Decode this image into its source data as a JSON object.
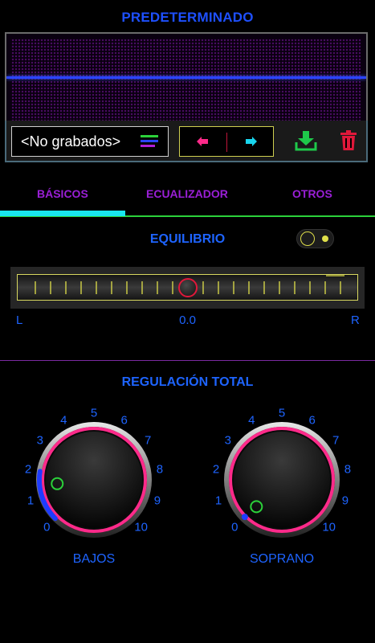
{
  "header": {
    "title": "PREDETERMINADO"
  },
  "preset": {
    "label": "<No grabados>"
  },
  "tabs": [
    {
      "label": "BÁSICOS",
      "active": true
    },
    {
      "label": "ECUALIZADOR",
      "active": false
    },
    {
      "label": "OTROS",
      "active": false
    }
  ],
  "balance": {
    "title": "EQUILIBRIO",
    "enabled": true,
    "left_label": "L",
    "right_label": "R",
    "value": "0.0"
  },
  "regulation": {
    "title": "REGULACIÓN TOTAL",
    "scale": [
      "0",
      "1",
      "2",
      "3",
      "4",
      "5",
      "6",
      "7",
      "8",
      "9",
      "10"
    ],
    "knobs": [
      {
        "name": "BAJOS",
        "level": 2.0
      },
      {
        "name": "SOPRANO",
        "level": 0.5
      }
    ]
  },
  "colors": {
    "accent_blue": "#1e64ff",
    "tab_purple": "#9a1fd6",
    "active_cyan": "#19e6ee",
    "knob_ring": "#ff2a8a",
    "save_green": "#1ec84a",
    "delete_red": "#e0183a"
  },
  "icons": [
    "list-icon",
    "arrow-left-icon",
    "arrow-right-icon",
    "download-icon",
    "trash-icon"
  ]
}
